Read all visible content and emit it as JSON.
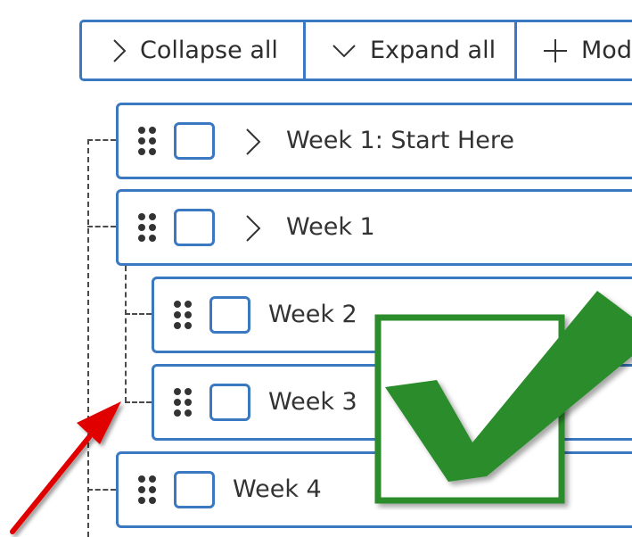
{
  "toolbar": {
    "collapse_label": "Collapse all",
    "expand_label": "Expand all",
    "module_label": "Mod"
  },
  "modules": [
    {
      "label": "Week 1: Start Here",
      "has_chevron": true,
      "indent": 0
    },
    {
      "label": "Week 1",
      "has_chevron": true,
      "indent": 0
    },
    {
      "label": "Week 2",
      "has_chevron": false,
      "indent": 1
    },
    {
      "label": "Week 3",
      "has_chevron": false,
      "indent": 1
    },
    {
      "label": "Week 4",
      "has_chevron": false,
      "indent": 0
    }
  ],
  "colors": {
    "accent": "#3a78c2",
    "check_green": "#2a8c2a",
    "arrow_red": "#e00000",
    "text": "#333333"
  },
  "annotations": {
    "overlay_icon": "green-checkmark-icon",
    "pointer_icon": "red-arrow-icon"
  }
}
